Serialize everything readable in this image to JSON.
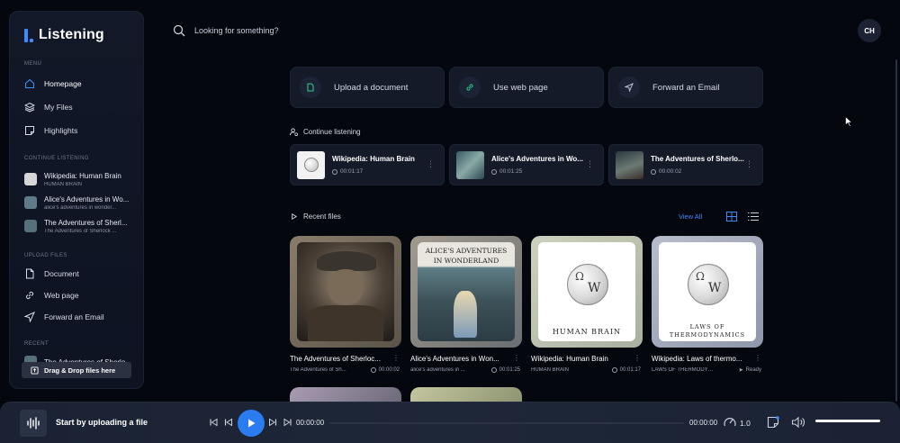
{
  "app": {
    "brand": "Listening"
  },
  "sidebar": {
    "menu_label": "MENU",
    "menu_items": [
      {
        "label": "Homepage",
        "icon": "home-icon"
      },
      {
        "label": "My Files",
        "icon": "layers-icon"
      },
      {
        "label": "Highlights",
        "icon": "note-icon"
      }
    ],
    "continue_label": "CONTINUE LISTENING",
    "continue_items": [
      {
        "title": "Wikipedia: Human Brain",
        "subtitle": "HUMAN BRAIN"
      },
      {
        "title": "Alice's Adventures in Wo...",
        "subtitle": "alice's adventures in wonder..."
      },
      {
        "title": "The Adventures of Sherl...",
        "subtitle": "The Adventures of Sherlock ..."
      }
    ],
    "upload_label": "UPLOAD FILES",
    "upload_items": [
      {
        "label": "Document",
        "icon": "document-icon"
      },
      {
        "label": "Web page",
        "icon": "link-icon"
      },
      {
        "label": "Forward an Email",
        "icon": "send-icon"
      }
    ],
    "recent_label": "RECENT",
    "recent_item": "The Adventures of Sherlo...",
    "drag_drop": "Drag & Drop files here"
  },
  "search": {
    "placeholder": "Looking for something?"
  },
  "user": {
    "initials": "CH"
  },
  "actions": [
    {
      "label": "Upload a document",
      "icon": "document-icon"
    },
    {
      "label": "Use web page",
      "icon": "link-icon"
    },
    {
      "label": "Forward an Email",
      "icon": "send-icon"
    }
  ],
  "continue_listening": {
    "title": "Continue listening",
    "cards": [
      {
        "title": "Wikipedia: Human Brain",
        "time": "00:01:17"
      },
      {
        "title": "Alice's Adventures in Wo...",
        "time": "00:01:25"
      },
      {
        "title": "The Adventures of Sherlo...",
        "time": "00:00:02"
      }
    ]
  },
  "recent_files": {
    "title": "Recent files",
    "view_all": "View All",
    "files": [
      {
        "title": "The Adventures of Sherloc...",
        "subtitle": "The Adventures of Sh...",
        "meta": "00:00:02"
      },
      {
        "title": "Alice's Adventures in Won...",
        "subtitle": "alice's adventures in ...",
        "meta": "00:01:25",
        "cover_text": "ALICE'S ADVENTURES IN WONDERLAND"
      },
      {
        "title": "Wikipedia: Human Brain",
        "subtitle": "HUMAN BRAIN",
        "meta": "00:01:17",
        "cover_text": "HUMAN BRAIN"
      },
      {
        "title": "Wikipedia: Laws of thermo...",
        "subtitle": "LAWS OF THERMODYNA...",
        "meta": "Ready",
        "cover_text": "LAWS OF THERMODYNAMICS"
      }
    ]
  },
  "player": {
    "title": "Start by uploading a file",
    "current_time": "00:00:00",
    "end_time": "00:00:00",
    "speed": "1.0",
    "volume": 1.0
  },
  "colors": {
    "accent": "#2a7cf0",
    "background": "#05070f",
    "card": "#141a28"
  }
}
